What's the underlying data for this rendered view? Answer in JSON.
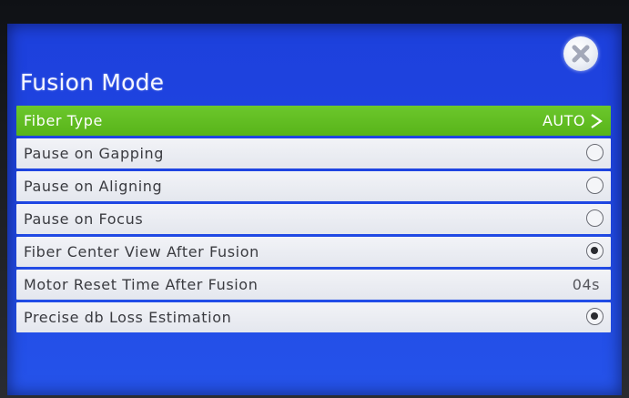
{
  "header": {
    "title": "Fusion Mode",
    "close_icon": "close-icon"
  },
  "menu": {
    "fiber_type": {
      "label": "Fiber Type",
      "value": "AUTO",
      "icon": "chevron-right-icon"
    },
    "pause_gapping": {
      "label": "Pause on Gapping",
      "checked": false
    },
    "pause_aligning": {
      "label": "Pause on Aligning",
      "checked": false
    },
    "pause_focus": {
      "label": "Pause on Focus",
      "checked": false
    },
    "fiber_center_view": {
      "label": "Fiber Center View After Fusion",
      "checked": true
    },
    "motor_reset": {
      "label": "Motor Reset Time After Fusion",
      "value": "04s"
    },
    "precise_loss": {
      "label": "Precise db Loss Estimation",
      "checked": true
    }
  },
  "colors": {
    "screen_blue": "#1f46e3",
    "selected_green": "#5fbd22",
    "row_bg": "#eceef3"
  }
}
